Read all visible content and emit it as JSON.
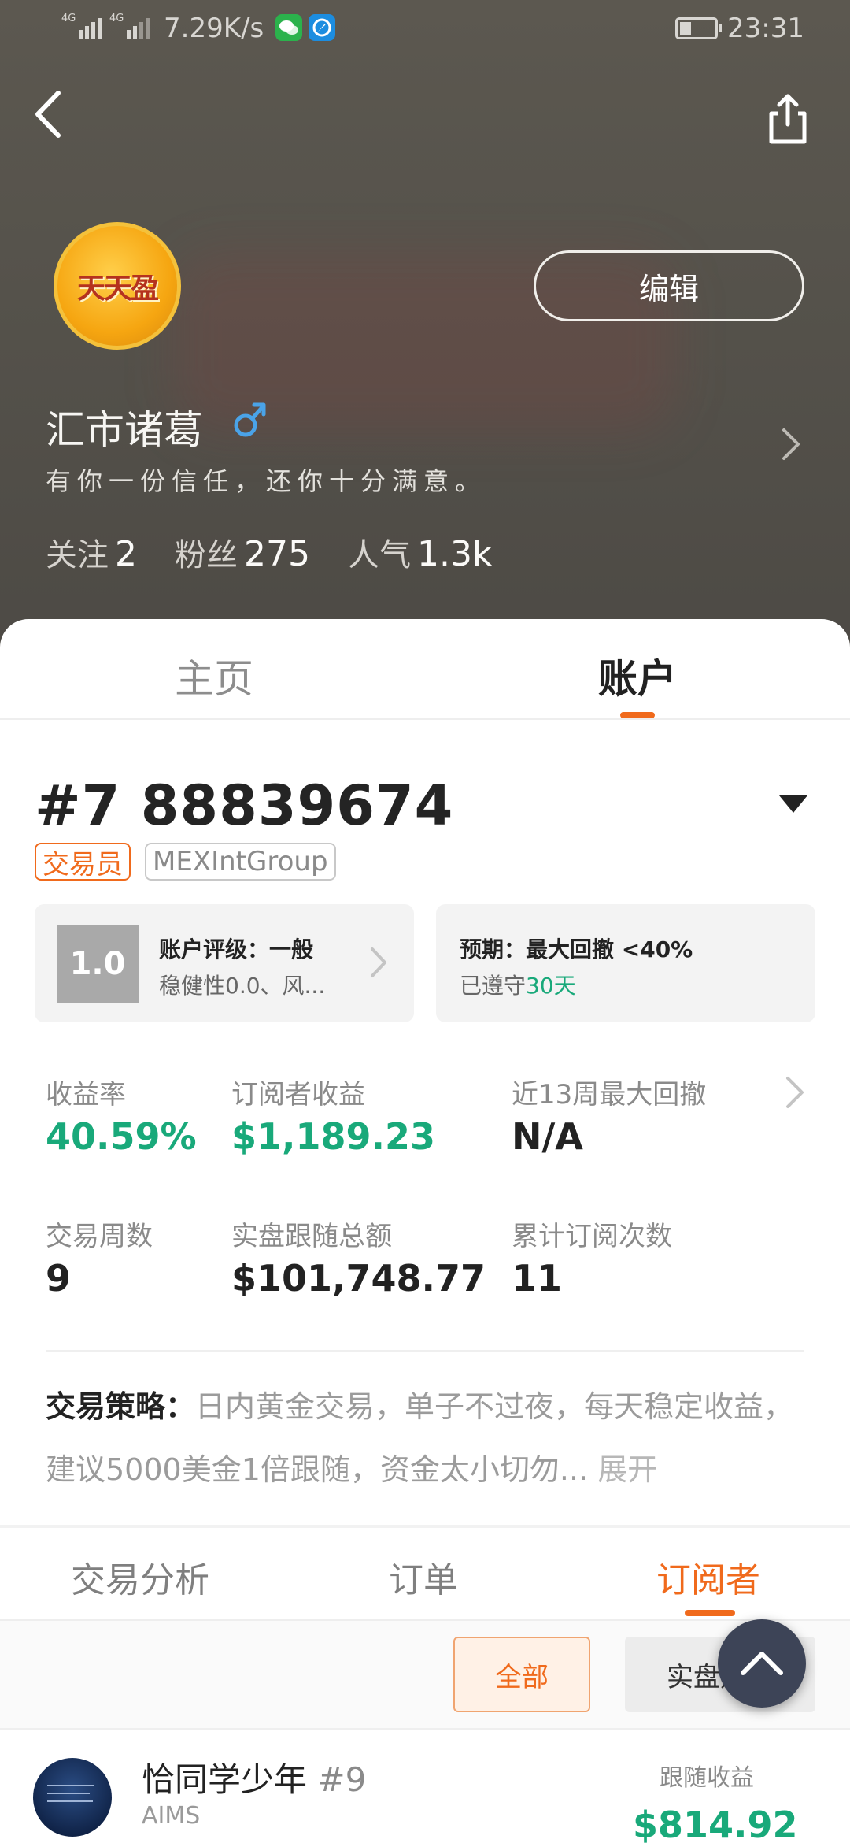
{
  "status_bar": {
    "network_1": "4G",
    "network_2": "4G",
    "speed": "7.29K/s",
    "time": "23:31",
    "battery_level": 0.25
  },
  "profile": {
    "avatar_text": "天天盈",
    "edit_label": "编辑",
    "name": "汇市诸葛",
    "motto": "有你一份信任，还你十分满意。",
    "stats": [
      {
        "label": "关注",
        "value": "2"
      },
      {
        "label": "粉丝",
        "value": "275"
      },
      {
        "label": "人气",
        "value": "1.3k"
      }
    ]
  },
  "tabs": [
    {
      "label": "主页"
    },
    {
      "label": "账户"
    }
  ],
  "account": {
    "number": "#7 88839674",
    "tag_role": "交易员",
    "tag_group": "MEXIntGroup",
    "rating_score": "1.0",
    "rating_title": "账户评级：一般",
    "rating_sub": "稳健性0.0、风...",
    "expect_title": "预期：最大回撤 <40%",
    "expect_sub_prefix": "已遵守",
    "expect_sub_days": "30天"
  },
  "metrics": [
    {
      "label": "收益率",
      "value": "40.59%"
    },
    {
      "label": "订阅者收益",
      "value": "$1,189.23"
    },
    {
      "label": "近13周最大回撤",
      "value": "N/A"
    },
    {
      "label": "交易周数",
      "value": "9"
    },
    {
      "label": "实盘跟随总额",
      "value": "$101,748.77"
    },
    {
      "label": "累计订阅次数",
      "value": "11"
    }
  ],
  "strategy": {
    "label": "交易策略：",
    "text": "日内黄金交易，单子不过夜，每天稳定收益，建议5000美金1倍跟随，资金太小切勿...",
    "expand": "展开"
  },
  "sub_tabs": [
    {
      "label": "交易分析"
    },
    {
      "label": "订单"
    },
    {
      "label": "订阅者"
    }
  ],
  "filters": {
    "all": "全部",
    "live": "实盘账户"
  },
  "subscriber": {
    "name": "恰同学少年",
    "rank": "#9",
    "broker": "AIMS",
    "profit_label": "跟随收益",
    "profit_value": "$814.92"
  },
  "colors": {
    "accent": "#f06a1c",
    "positive": "#19a97a"
  }
}
